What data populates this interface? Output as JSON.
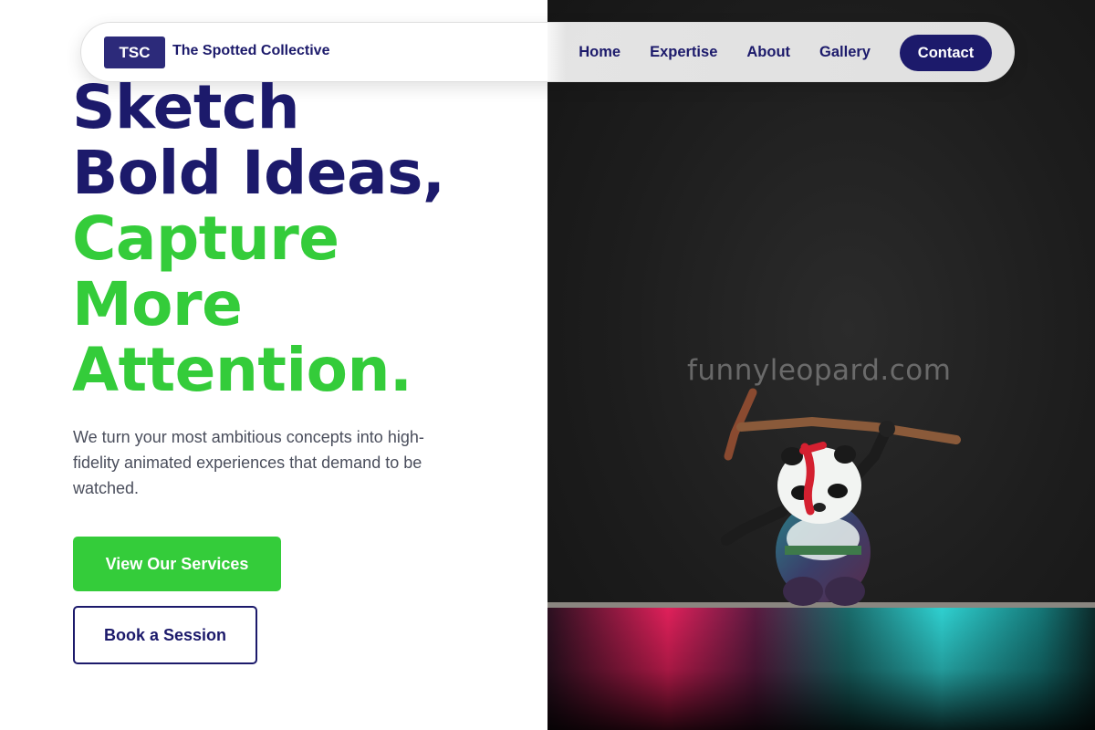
{
  "nav": {
    "logo_text": "TSC",
    "brand_name": "The Spotted Collective",
    "links": [
      "Home",
      "Expertise",
      "About",
      "Gallery"
    ],
    "cta_label": "Contact"
  },
  "hero": {
    "headline_lines": [
      "Sketch",
      "Bold Ideas,",
      "Capture",
      "More",
      "Attention."
    ],
    "lede": "We turn your most ambitious concepts into high-fidelity animated experiences that demand to be watched.",
    "primary_button": "View Our Services",
    "secondary_button": "Book a Session"
  },
  "photo": {
    "watermark": "funnyleopard.com",
    "subject": "panda-warrior-figurine"
  },
  "colors": {
    "navy": "#1c1a6b",
    "green": "#34cc3a",
    "body_text": "#4a4e5c",
    "photo_bg": "#1d1d1d"
  }
}
